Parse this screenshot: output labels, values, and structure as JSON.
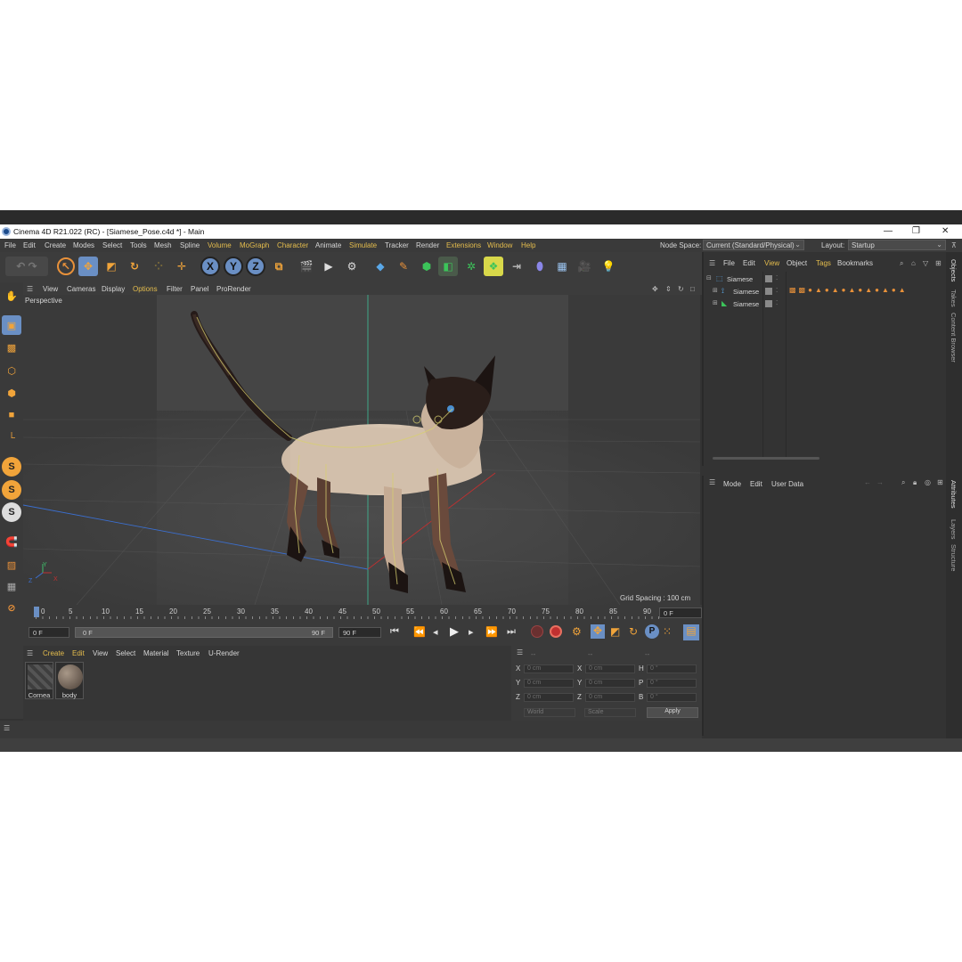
{
  "window": {
    "title": "Cinema 4D R21.022 (RC) - [Siamese_Pose.c4d *] - Main",
    "controls": [
      "—",
      "❐",
      "✕"
    ]
  },
  "menubar": {
    "items": [
      "File",
      "Edit",
      "Create",
      "Modes",
      "Select",
      "Tools",
      "Mesh",
      "Spline",
      "Volume",
      "MoGraph",
      "Character",
      "Animate",
      "Simulate",
      "Tracker",
      "Render",
      "Extensions",
      "Window",
      "Help"
    ],
    "node_space_label": "Node Space:",
    "node_space_value": "Current (Standard/Physical)",
    "layout_label": "Layout:",
    "layout_value": "Startup"
  },
  "toolbar": {
    "axis_x": "X",
    "axis_y": "Y",
    "axis_z": "Z"
  },
  "leftbar": {
    "s1": "S",
    "s2": "S",
    "s3": "S"
  },
  "viewport": {
    "menu": [
      "View",
      "Cameras",
      "Display",
      "Options",
      "Filter",
      "Panel",
      "ProRender"
    ],
    "label": "Perspective",
    "grid_spacing": "Grid Spacing : 100 cm",
    "axis_y": "Y",
    "axis_z": "Z",
    "axis_x": "X"
  },
  "timeline": {
    "ticks": [
      "0",
      "5",
      "10",
      "15",
      "20",
      "25",
      "30",
      "35",
      "40",
      "45",
      "50",
      "55",
      "60",
      "65",
      "70",
      "75",
      "80",
      "85",
      "90"
    ],
    "current_frame": "0 F",
    "start": "0 F",
    "slider_start": "0 F",
    "slider_end": "90 F",
    "end": "90 F"
  },
  "material_manager": {
    "menu": [
      "Create",
      "Edit",
      "View",
      "Select",
      "Material",
      "Texture",
      "U-Render"
    ],
    "materials": [
      "Cornea",
      "body"
    ]
  },
  "coordinates": {
    "head": [
      "--",
      "--",
      "--"
    ],
    "rows": [
      {
        "l1": "X",
        "v1": "0 cm",
        "l2": "X",
        "v2": "0 cm",
        "l3": "H",
        "v3": "0 °"
      },
      {
        "l1": "Y",
        "v1": "0 cm",
        "l2": "Y",
        "v2": "0 cm",
        "l3": "P",
        "v3": "0 °"
      },
      {
        "l1": "Z",
        "v1": "0 cm",
        "l2": "Z",
        "v2": "0 cm",
        "l3": "B",
        "v3": "0 °"
      }
    ],
    "world": "World",
    "scale": "Scale",
    "apply": "Apply"
  },
  "object_manager": {
    "menu": [
      "File",
      "Edit",
      "View",
      "Object",
      "Tags",
      "Bookmarks"
    ],
    "objects": [
      "Siamese",
      "Siamese",
      "Siamese"
    ]
  },
  "attributes": {
    "menu": [
      "Mode",
      "Edit",
      "User Data"
    ]
  },
  "side_tabs": {
    "top": [
      "Objects",
      "Takes",
      "Content Browser"
    ],
    "bottom": [
      "Attributes",
      "Layers",
      "Structure"
    ]
  },
  "colors": {
    "accent_orange": "#e8913a",
    "highlight_yellow": "#e5bd4d",
    "active_blue": "#6a8fc4",
    "bg_dark": "#333333"
  }
}
